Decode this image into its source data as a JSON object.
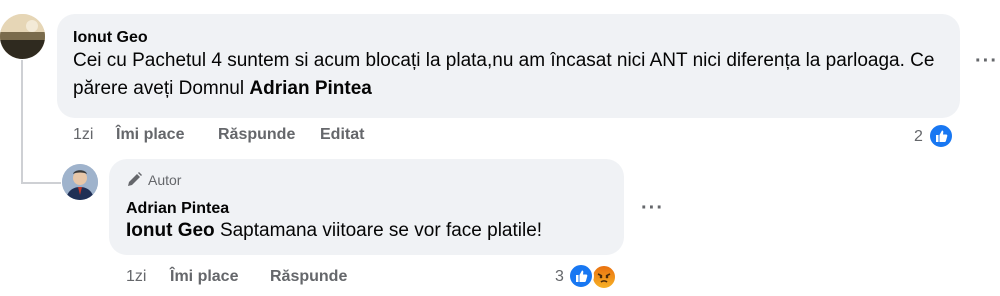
{
  "comment": {
    "author": "Ionut Geo",
    "text_main": "Cei cu Pachetul 4 suntem si acum blocați la plata,nu am încasat nici ANT nici diferența la parloaga. Ce părere aveți Domnul",
    "mention": "Adrian Pintea",
    "time": "1zi",
    "like_label": "Îmi place",
    "reply_label": "Răspunde",
    "edited_label": "Editat",
    "reaction_count": "2",
    "more_label": "···"
  },
  "reply": {
    "badge_label": "Autor",
    "author": "Adrian Pintea",
    "mention": "Ionut Geo",
    "text": "Saptamana viitoare se vor face platile!",
    "time": "1zi",
    "like_label": "Îmi place",
    "reply_label": "Răspunde",
    "reaction_count": "3",
    "more_label": "···"
  },
  "colors": {
    "bubble": "#f0f2f5",
    "meta_text": "#65676b",
    "like_blue": "#1877f2",
    "thread_line": "#ced0d4"
  },
  "icons": [
    "avatar-photo",
    "pencil-icon",
    "like-icon",
    "angry-icon",
    "more-options-icon"
  ]
}
